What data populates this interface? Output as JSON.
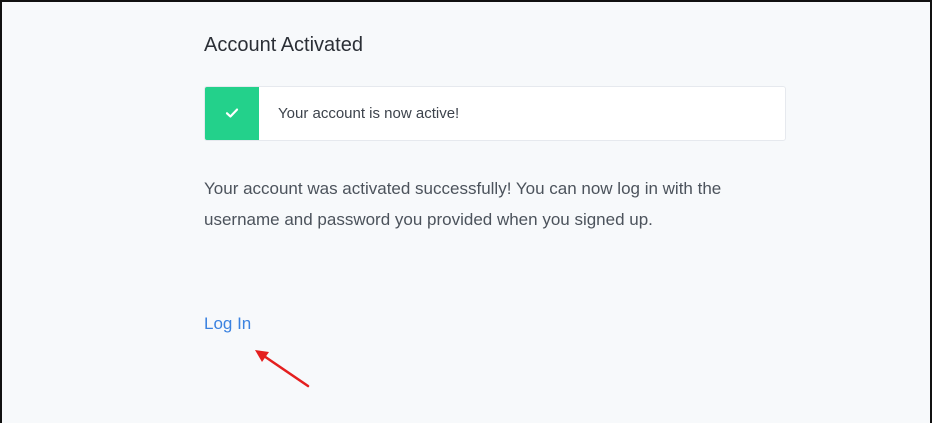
{
  "page": {
    "title": "Account Activated"
  },
  "alert": {
    "text": "Your account is now active!",
    "icon": "check-icon",
    "accent_color": "#23d18b"
  },
  "message": {
    "text": "Your account was activated successfully! You can now log in with the username and password you provided when you signed up."
  },
  "login": {
    "label": "Log In",
    "color": "#3b82e0"
  },
  "annotation": {
    "icon": "red-arrow-icon",
    "color": "#e41f1f"
  }
}
